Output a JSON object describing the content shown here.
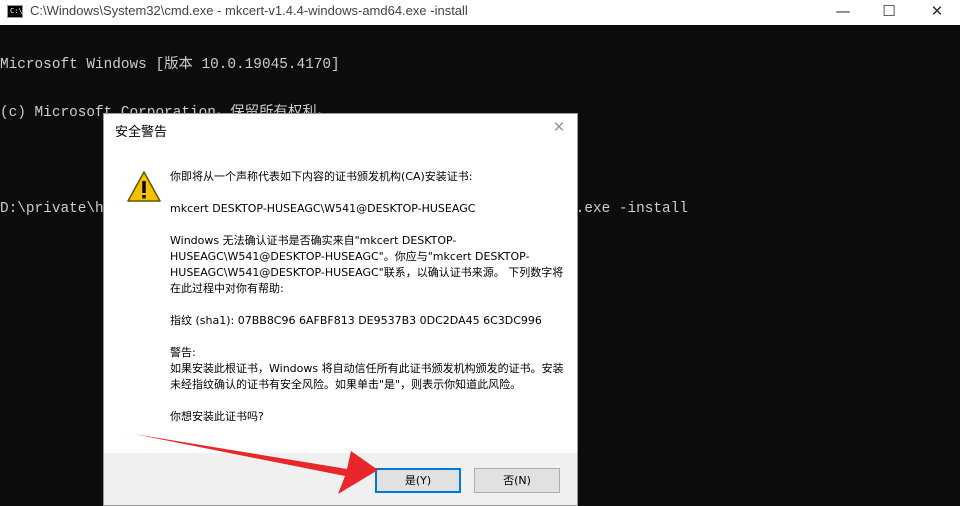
{
  "window": {
    "title": "C:\\Windows\\System32\\cmd.exe - mkcert-v1.4.4-windows-amd64.exe  -install",
    "minimize_icon": "minimize-icon",
    "maximize_icon": "maximize-icon",
    "close_icon": "close-icon"
  },
  "console": {
    "lines": [
      "Microsoft Windows [版本 10.0.19045.4170]",
      "(c) Microsoft Corporation。保留所有权利。",
      "",
      "D:\\private\\https部署相关\\https证书生成工具>mkcert-v1.4.4-windows-amd64.exe -install"
    ]
  },
  "dialog": {
    "title": "安全警告",
    "icon": "warning-icon",
    "para1": "你即将从一个声称代表如下内容的证书颁发机构(CA)安装证书:",
    "para2": "mkcert DESKTOP-HUSEAGC\\W541@DESKTOP-HUSEAGC",
    "para3": "Windows 无法确认证书是否确实来自\"mkcert DESKTOP-HUSEAGC\\W541@DESKTOP-HUSEAGC\"。你应与\"mkcert DESKTOP-HUSEAGC\\W541@DESKTOP-HUSEAGC\"联系，以确认证书来源。 下列数字将在此过程中对你有帮助:",
    "para4": "指纹 (sha1): 07BB8C96 6AFBF813 DE9537B3 0DC2DA45 6C3DC996",
    "warning_heading": "警告:",
    "warning_text": "如果安装此根证书，Windows 将自动信任所有此证书颁发机构颁发的证书。安装未经指纹确认的证书有安全风险。如果单击\"是\"，则表示你知道此风险。",
    "question": "你想安装此证书吗?",
    "yes_button": "是(Y)",
    "no_button": "否(N)"
  },
  "colors": {
    "console_bg": "#0c0c0c",
    "console_text": "#cccccc",
    "default_button_border": "#0078d7",
    "annotation_arrow": "#e8262b"
  }
}
